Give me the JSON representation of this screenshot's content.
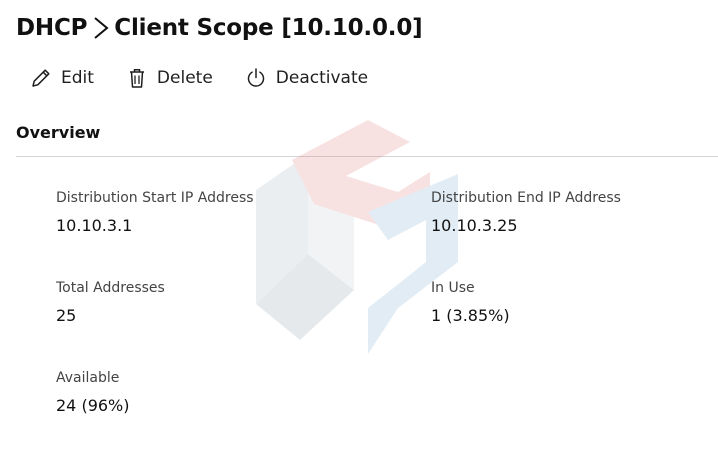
{
  "breadcrumb": {
    "parent": "DHCP",
    "current": "Client Scope [10.10.0.0]"
  },
  "toolbar": {
    "edit_label": "Edit",
    "delete_label": "Delete",
    "deactivate_label": "Deactivate",
    "icons": [
      "pencil-icon",
      "trash-icon",
      "power-icon"
    ]
  },
  "overview": {
    "title": "Overview",
    "fields": {
      "distribution_start": {
        "label": "Distribution Start IP Address",
        "value": "10.10.3.1"
      },
      "distribution_end": {
        "label": "Distribution End IP Address",
        "value": "10.10.3.25"
      },
      "total_addresses": {
        "label": "Total Addresses",
        "value": "25"
      },
      "in_use": {
        "label": "In Use",
        "value": "1 (3.85%)"
      },
      "available": {
        "label": "Available",
        "value": "24 (96%)"
      }
    }
  },
  "colors": {
    "watermark_red": "#e07b7b",
    "watermark_blue": "#7aaed6",
    "watermark_grey": "#a9b6c2",
    "divider": "#d4d4d4"
  }
}
